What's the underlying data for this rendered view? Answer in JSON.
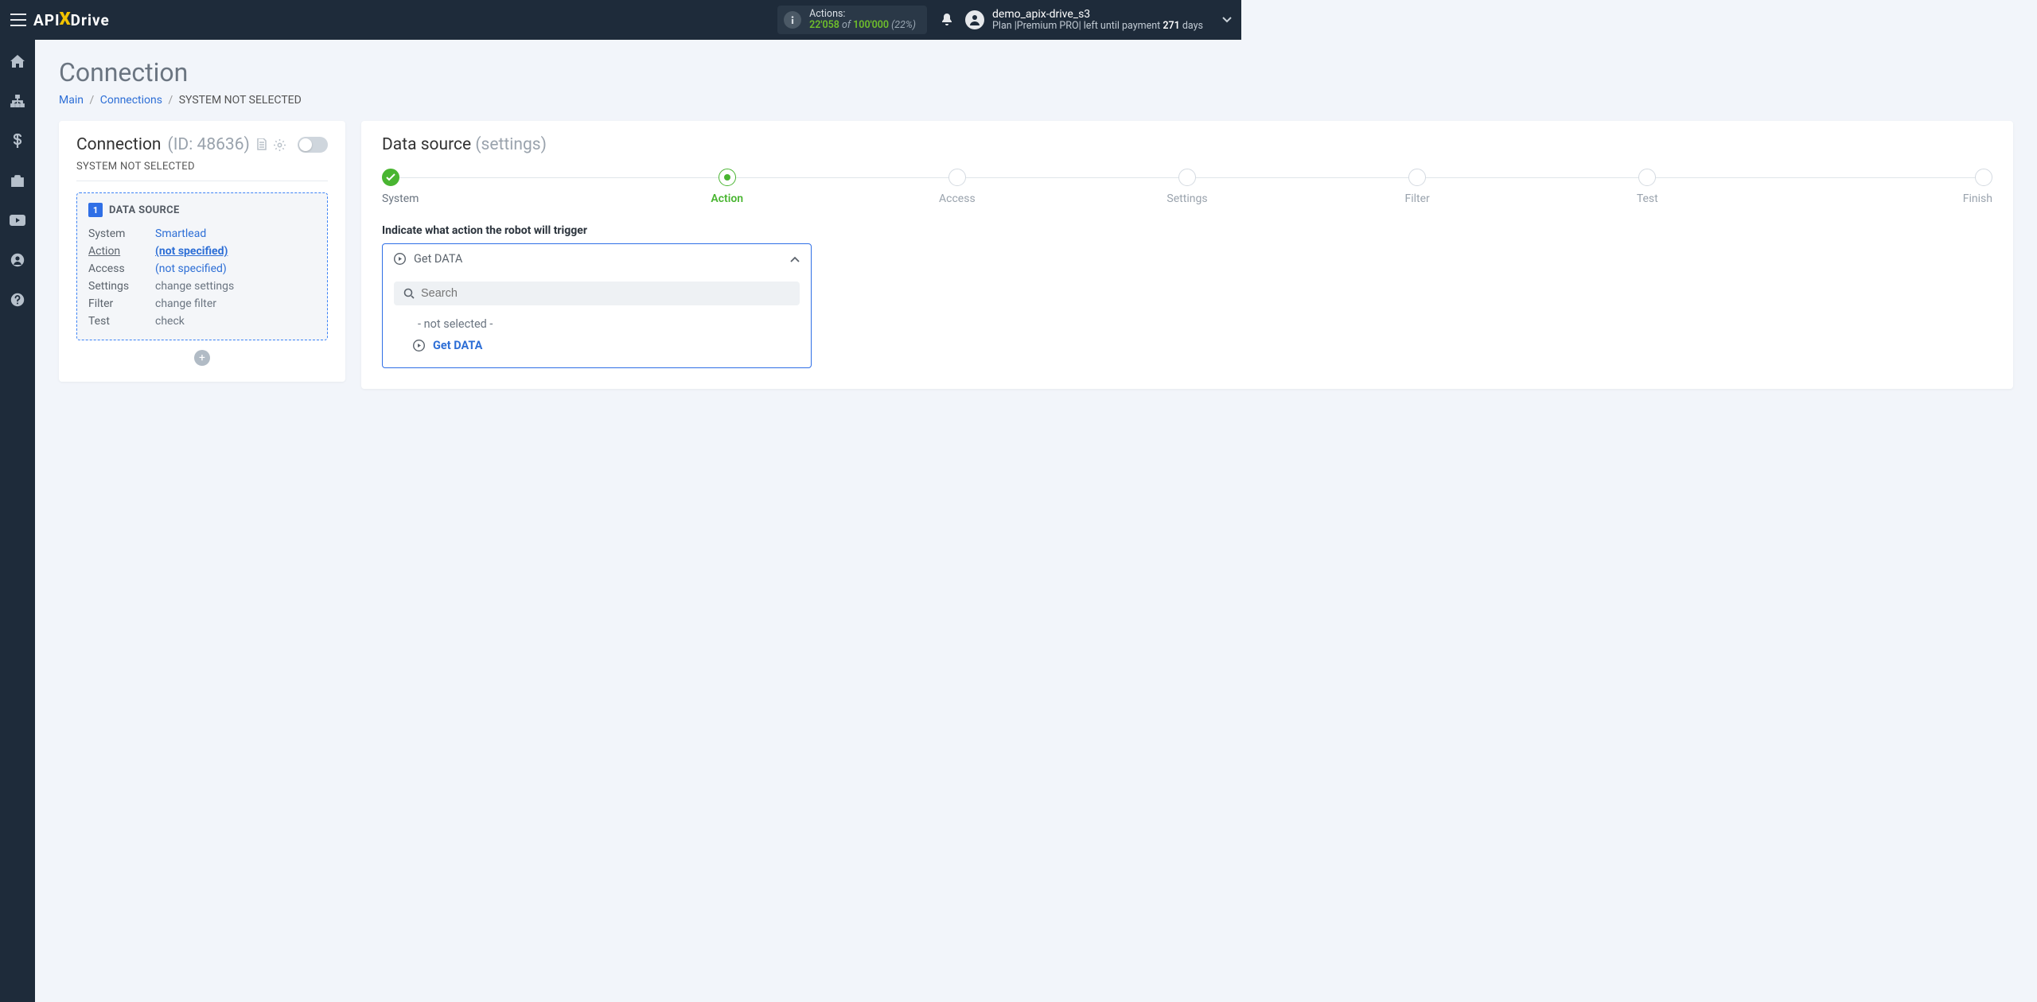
{
  "logo": {
    "prefix": "API",
    "x": "X",
    "suffix": "Drive"
  },
  "topbar": {
    "actions": {
      "label": "Actions:",
      "count": "22'058",
      "of": " of ",
      "limit": "100'000",
      "pct": " (22%)"
    },
    "user": {
      "name": "demo_apix-drive_s3",
      "plan_prefix": "Plan |",
      "plan_name": "Premium PRO",
      "plan_mid": "| left until payment ",
      "plan_days": "271",
      "plan_suffix": " days"
    }
  },
  "page": {
    "title": "Connection",
    "breadcrumb": {
      "main": "Main",
      "connections": "Connections",
      "current": "SYSTEM NOT SELECTED"
    }
  },
  "leftcard": {
    "title": "Connection",
    "id_prefix": " (ID: ",
    "id": "48636",
    "id_suffix": ")",
    "subtitle": "SYSTEM NOT SELECTED",
    "datasource": {
      "badge": "1",
      "title": "DATA SOURCE",
      "rows": {
        "system": {
          "k": "System",
          "v": "Smartlead"
        },
        "action": {
          "k": "Action",
          "v": "(not specified)"
        },
        "access": {
          "k": "Access",
          "v": "(not specified)"
        },
        "settings": {
          "k": "Settings",
          "v": "change settings"
        },
        "filter": {
          "k": "Filter",
          "v": "change filter"
        },
        "test": {
          "k": "Test",
          "v": "check"
        }
      }
    }
  },
  "rightcard": {
    "title": "Data source ",
    "subtitle": "(settings)",
    "steps": {
      "system": "System",
      "action": "Action",
      "access": "Access",
      "settings": "Settings",
      "filter": "Filter",
      "test": "Test",
      "finish": "Finish"
    },
    "field_label": "Indicate what action the robot will trigger",
    "dropdown": {
      "selected": "Get DATA",
      "search_placeholder": "Search",
      "options": {
        "not_selected": "- not selected -",
        "get_data": "Get DATA"
      }
    }
  }
}
